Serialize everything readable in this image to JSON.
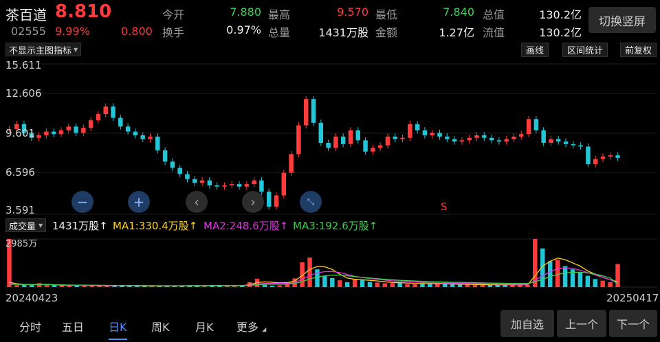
{
  "stock": {
    "name": "茶百道",
    "price": "8.810",
    "code": "02555",
    "change_pct": "9.99%",
    "change_amt": "0.800"
  },
  "quote": {
    "open_label": "今开",
    "open_value": "7.880",
    "high_label": "最高",
    "high_value": "9.570",
    "low_label": "最低",
    "low_value": "7.840",
    "total_mv_label": "总值",
    "total_mv_value": "130.2亿",
    "turnover_label": "换手",
    "turnover_value": "0.97%",
    "volume_label": "总量",
    "volume_value": "1431万股",
    "amount_label": "金额",
    "amount_value": "1.27亿",
    "float_mv_label": "流值",
    "float_mv_value": "130.2亿"
  },
  "header": {
    "switch_portrait_label": "切换竖屏"
  },
  "toolbar": {
    "indicator_select": "不显示主图指标",
    "draw_line": "画线",
    "range_stats": "区间统计",
    "adjust": "前复权"
  },
  "chart_axis": {
    "y_ticks": [
      "15.611",
      "12.606",
      "9.601",
      "6.596",
      "3.591"
    ]
  },
  "marker": {
    "s_label": "S"
  },
  "volume": {
    "select_label": "成交量",
    "current": "1431万股↑",
    "ma1": "MA1:330.4万股↑",
    "ma2": "MA2:248.6万股↑",
    "ma3": "MA3:192.6万股↑",
    "max_label": "2985万",
    "start_date": "20240423",
    "end_date": "20250417"
  },
  "bottom_tabs": [
    "分时",
    "五日",
    "日K",
    "周K",
    "月K",
    "更多"
  ],
  "bottom_buttons": {
    "add_watch": "加自选",
    "prev": "上一个",
    "next": "下一个"
  },
  "colors": {
    "up": "#ff3b3b",
    "down": "#22c6d6",
    "ma1": "#ffd21e",
    "ma2": "#e233e2",
    "ma3": "#3fcf4a",
    "accent": "#4f8fff"
  },
  "chart_data": {
    "type": "candlestick",
    "y_range": [
      3.591,
      15.611
    ],
    "close_series": [
      10.4,
      10.8,
      10.1,
      9.7,
      9.9,
      10.2,
      10.0,
      10.3,
      10.6,
      10.1,
      10.5,
      11.1,
      11.6,
      12.2,
      11.3,
      10.6,
      10.2,
      9.9,
      9.6,
      9.8,
      8.7,
      7.8,
      7.3,
      6.8,
      6.4,
      6.1,
      6.3,
      5.9,
      5.8,
      5.9,
      6.0,
      5.8,
      6.0,
      6.3,
      5.4,
      4.2,
      5.1,
      6.9,
      8.4,
      10.7,
      12.8,
      10.9,
      9.3,
      8.9,
      9.8,
      9.2,
      10.3,
      9.5,
      8.6,
      8.9,
      9.1,
      9.8,
      9.6,
      9.7,
      10.8,
      10.3,
      9.9,
      10.1,
      9.8,
      9.6,
      9.4,
      9.5,
      9.7,
      9.9,
      9.7,
      9.5,
      9.4,
      9.6,
      9.8,
      10.0,
      11.2,
      10.3,
      9.3,
      9.6,
      9.4,
      9.2,
      9.1,
      9.0,
      7.6,
      8.0,
      8.2,
      8.3,
      8.1
    ],
    "volume_series": [
      2985,
      120,
      150,
      180,
      240,
      120,
      130,
      100,
      110,
      110,
      140,
      90,
      80,
      80,
      90,
      100,
      90,
      80,
      60,
      70,
      60,
      70,
      80,
      90,
      100,
      90,
      80,
      90,
      120,
      90,
      70,
      90,
      300,
      520,
      140,
      90,
      110,
      300,
      540,
      1540,
      1830,
      1100,
      700,
      560,
      420,
      300,
      500,
      460,
      320,
      280,
      230,
      250,
      270,
      180,
      170,
      220,
      250,
      200,
      180,
      170,
      160,
      150,
      140,
      140,
      130,
      140,
      130,
      150,
      140,
      150,
      2985,
      2400,
      1600,
      1700,
      1300,
      1100,
      900,
      700,
      500,
      400,
      300,
      1431
    ],
    "ma1_series": [
      300,
      210,
      160,
      150,
      170,
      160,
      140,
      120,
      110,
      110,
      120,
      110,
      100,
      90,
      90,
      95,
      95,
      90,
      80,
      75,
      70,
      70,
      75,
      80,
      90,
      90,
      90,
      95,
      100,
      100,
      95,
      90,
      150,
      280,
      320,
      300,
      260,
      270,
      380,
      720,
      1100,
      1280,
      1260,
      1100,
      800,
      560,
      480,
      450,
      420,
      380,
      330,
      290,
      270,
      250,
      230,
      220,
      210,
      210,
      200,
      190,
      180,
      170,
      160,
      150,
      145,
      140,
      140,
      140,
      140,
      145,
      700,
      1300,
      1600,
      1800,
      1700,
      1500,
      1300,
      1000,
      800,
      600,
      450,
      330
    ],
    "ma2_series": [
      220,
      180,
      160,
      150,
      155,
      150,
      140,
      130,
      120,
      115,
      115,
      110,
      105,
      100,
      95,
      95,
      95,
      92,
      88,
      84,
      80,
      78,
      78,
      80,
      84,
      86,
      88,
      90,
      92,
      94,
      94,
      92,
      120,
      190,
      230,
      240,
      230,
      230,
      290,
      480,
      720,
      880,
      960,
      970,
      900,
      780,
      670,
      590,
      530,
      480,
      430,
      390,
      360,
      330,
      310,
      290,
      270,
      260,
      250,
      240,
      230,
      220,
      210,
      200,
      190,
      180,
      175,
      170,
      165,
      165,
      400,
      700,
      950,
      1150,
      1200,
      1150,
      1050,
      900,
      750,
      600,
      450,
      249
    ],
    "ma3_series": [
      180,
      165,
      155,
      150,
      150,
      148,
      142,
      135,
      128,
      122,
      118,
      114,
      110,
      106,
      102,
      100,
      98,
      96,
      93,
      90,
      87,
      85,
      84,
      84,
      85,
      86,
      87,
      88,
      89,
      90,
      91,
      91,
      105,
      140,
      170,
      180,
      180,
      185,
      220,
      340,
      500,
      620,
      700,
      740,
      740,
      700,
      650,
      600,
      560,
      520,
      480,
      450,
      420,
      395,
      375,
      355,
      340,
      325,
      310,
      300,
      290,
      280,
      270,
      260,
      250,
      242,
      236,
      230,
      224,
      220,
      330,
      480,
      640,
      790,
      880,
      920,
      920,
      880,
      800,
      700,
      560,
      193
    ]
  }
}
